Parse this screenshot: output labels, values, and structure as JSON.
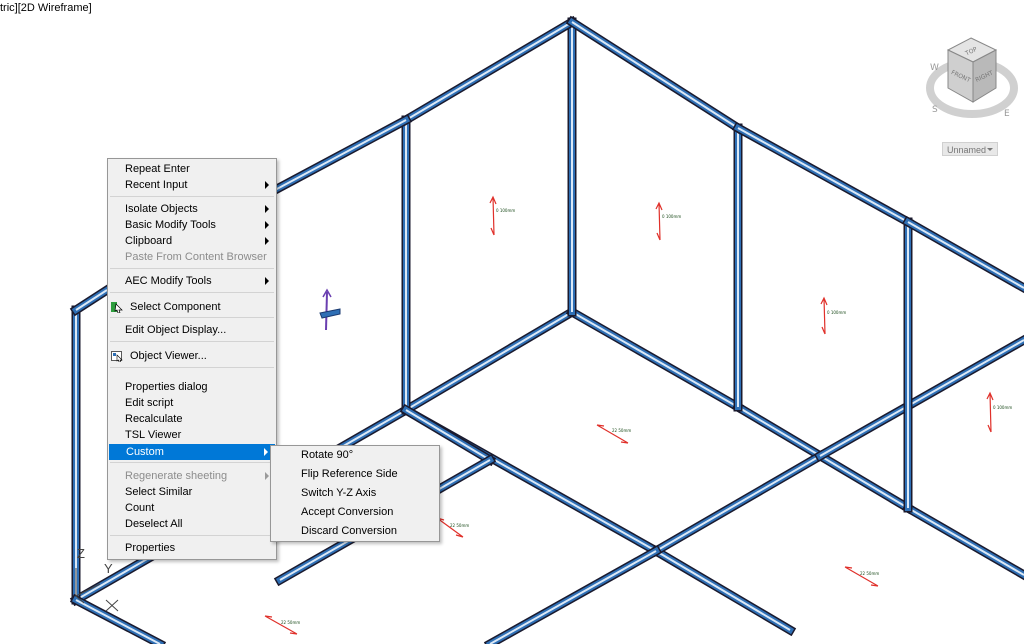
{
  "viewport": {
    "label": "tric][2D Wireframe]",
    "dimension_labels": [
      "0 100mm",
      "0 100mm",
      "0 100mm",
      "0 100mm",
      "22 50mm",
      "22 50mm",
      "22 50mm",
      "22 50mm"
    ]
  },
  "ucs": {
    "axis_z": "Z",
    "axis_y": "Y"
  },
  "navcube": {
    "top": "TOP",
    "front": "FRONT",
    "right": "RIGHT",
    "compass_s": "S",
    "compass_e": "E",
    "compass_w": "W",
    "view_name": "Unnamed"
  },
  "context_menu": {
    "items": [
      {
        "label": "Repeat Enter"
      },
      {
        "label": "Recent Input"
      },
      {
        "label": "Isolate Objects"
      },
      {
        "label": "Basic Modify Tools"
      },
      {
        "label": "Clipboard"
      },
      {
        "label": "Paste From Content Browser"
      },
      {
        "label": "AEC Modify Tools"
      },
      {
        "label": "Select Component"
      },
      {
        "label": "Edit Object Display..."
      },
      {
        "label": "Object Viewer..."
      },
      {
        "label": "Properties dialog"
      },
      {
        "label": "Edit script"
      },
      {
        "label": "Recalculate"
      },
      {
        "label": "TSL Viewer"
      },
      {
        "label": "Custom"
      },
      {
        "label": "Regenerate sheeting"
      },
      {
        "label": "Select Similar"
      },
      {
        "label": "Count"
      },
      {
        "label": "Deselect All"
      },
      {
        "label": "Properties"
      }
    ]
  },
  "custom_submenu": {
    "items": [
      {
        "label": "Rotate 90°"
      },
      {
        "label": "Flip Reference Side"
      },
      {
        "label": "Switch Y-Z Axis"
      },
      {
        "label": "Accept Conversion"
      },
      {
        "label": "Discard Conversion"
      }
    ]
  },
  "colors": {
    "highlight": "#0078d7",
    "frame_outline": "#1a1a2e",
    "frame_fill": "#2e6fb5",
    "arrow": "#e0302a"
  }
}
